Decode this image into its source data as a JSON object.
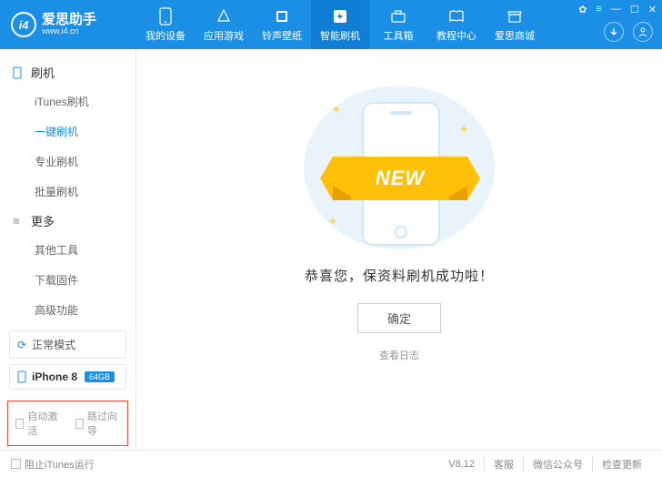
{
  "logo": {
    "main": "爱思助手",
    "sub": "www.i4.cn",
    "badge": "i4"
  },
  "nav": {
    "items": [
      {
        "label": "我的设备"
      },
      {
        "label": "应用游戏"
      },
      {
        "label": "铃声壁纸"
      },
      {
        "label": "智能刷机"
      },
      {
        "label": "工具箱"
      },
      {
        "label": "教程中心"
      },
      {
        "label": "爱思商城"
      }
    ]
  },
  "sidebar": {
    "section1": {
      "title": "刷机",
      "items": [
        "iTunes刷机",
        "一键刷机",
        "专业刷机",
        "批量刷机"
      ]
    },
    "section2": {
      "title": "更多",
      "items": [
        "其他工具",
        "下载固件",
        "高级功能"
      ]
    },
    "mode": "正常模式",
    "device": {
      "name": "iPhone 8",
      "capacity": "64GB"
    },
    "options": {
      "opt1": "自动激活",
      "opt2": "跳过向导"
    }
  },
  "main": {
    "ribbon": "NEW",
    "message": "恭喜您，保资料刷机成功啦！",
    "ok": "确定",
    "log": "查看日志"
  },
  "footer": {
    "block": "阻止iTunes运行",
    "version": "V8.12",
    "items": [
      "客服",
      "微信公众号",
      "检查更新"
    ]
  }
}
